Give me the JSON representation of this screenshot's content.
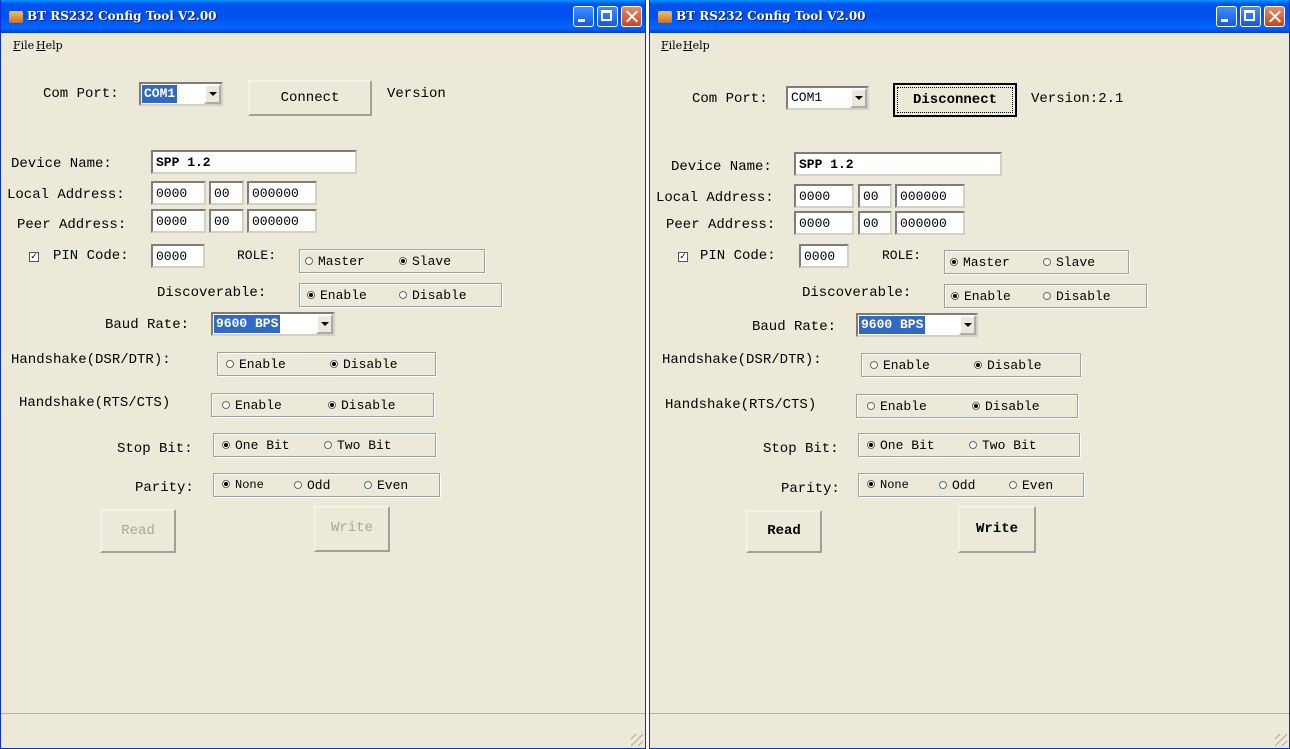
{
  "window1": {
    "title": "BT RS232 Config Tool  V2.00",
    "menu": [
      "File",
      "Help"
    ],
    "com_port_label": "Com Port:",
    "com_port_value": "COM1",
    "connect_button": "Connect",
    "version_label": "Version",
    "device_name_label": "Device Name:",
    "device_name_value": "SPP 1.2",
    "local_address_label": "Local Address:",
    "local_address": [
      "0000",
      "00",
      "000000"
    ],
    "peer_address_label": "Peer Address:",
    "peer_address": [
      "0000",
      "00",
      "000000"
    ],
    "pin_code_label": "PIN Code:",
    "pin_code_checked": true,
    "pin_code_value": "0000",
    "role_label": "ROLE:",
    "role_options": [
      "Master",
      "Slave"
    ],
    "role_selected": "Slave",
    "discoverable_label": "Discoverable:",
    "discoverable_options": [
      "Enable",
      "Disable"
    ],
    "discoverable_selected": "Enable",
    "baud_rate_label": "Baud Rate:",
    "baud_rate_value": "9600 BPS",
    "handshake_dsr_label": "Handshake(DSR/DTR):",
    "handshake_dsr_options": [
      "Enable",
      "Disable"
    ],
    "handshake_dsr_selected": "Disable",
    "handshake_rts_label": "Handshake(RTS/CTS)",
    "handshake_rts_options": [
      "Enable",
      "Disable"
    ],
    "handshake_rts_selected": "Disable",
    "stop_bit_label": "Stop Bit:",
    "stop_bit_options": [
      "One Bit",
      "Two Bit"
    ],
    "stop_bit_selected": "One Bit",
    "parity_label": "Parity:",
    "parity_options": [
      "None",
      "Odd",
      "Even"
    ],
    "parity_selected": "None",
    "read_button": "Read",
    "write_button": "Write",
    "buttons_enabled": false
  },
  "window2": {
    "title": "BT RS232 Config Tool  V2.00",
    "menu": [
      "File",
      "Help"
    ],
    "com_port_label": "Com Port:",
    "com_port_value": "COM1",
    "connect_button": "Disconnect",
    "version_label": "Version:2.1",
    "device_name_label": "Device Name:",
    "device_name_value": "SPP 1.2",
    "local_address_label": "Local Address:",
    "local_address": [
      "0000",
      "00",
      "000000"
    ],
    "peer_address_label": "Peer Address:",
    "peer_address": [
      "0000",
      "00",
      "000000"
    ],
    "pin_code_label": "PIN Code:",
    "pin_code_checked": true,
    "pin_code_value": "0000",
    "role_label": "ROLE:",
    "role_options": [
      "Master",
      "Slave"
    ],
    "role_selected": "Master",
    "discoverable_label": "Discoverable:",
    "discoverable_options": [
      "Enable",
      "Disable"
    ],
    "discoverable_selected": "Enable",
    "baud_rate_label": "Baud Rate:",
    "baud_rate_value": "9600 BPS",
    "handshake_dsr_label": "Handshake(DSR/DTR):",
    "handshake_dsr_options": [
      "Enable",
      "Disable"
    ],
    "handshake_dsr_selected": "Disable",
    "handshake_rts_label": "Handshake(RTS/CTS)",
    "handshake_rts_options": [
      "Enable",
      "Disable"
    ],
    "handshake_rts_selected": "Disable",
    "stop_bit_label": "Stop Bit:",
    "stop_bit_options": [
      "One Bit",
      "Two Bit"
    ],
    "stop_bit_selected": "One Bit",
    "parity_label": "Parity:",
    "parity_options": [
      "None",
      "Odd",
      "Even"
    ],
    "parity_selected": "None",
    "read_button": "Read",
    "write_button": "Write",
    "buttons_enabled": true
  }
}
